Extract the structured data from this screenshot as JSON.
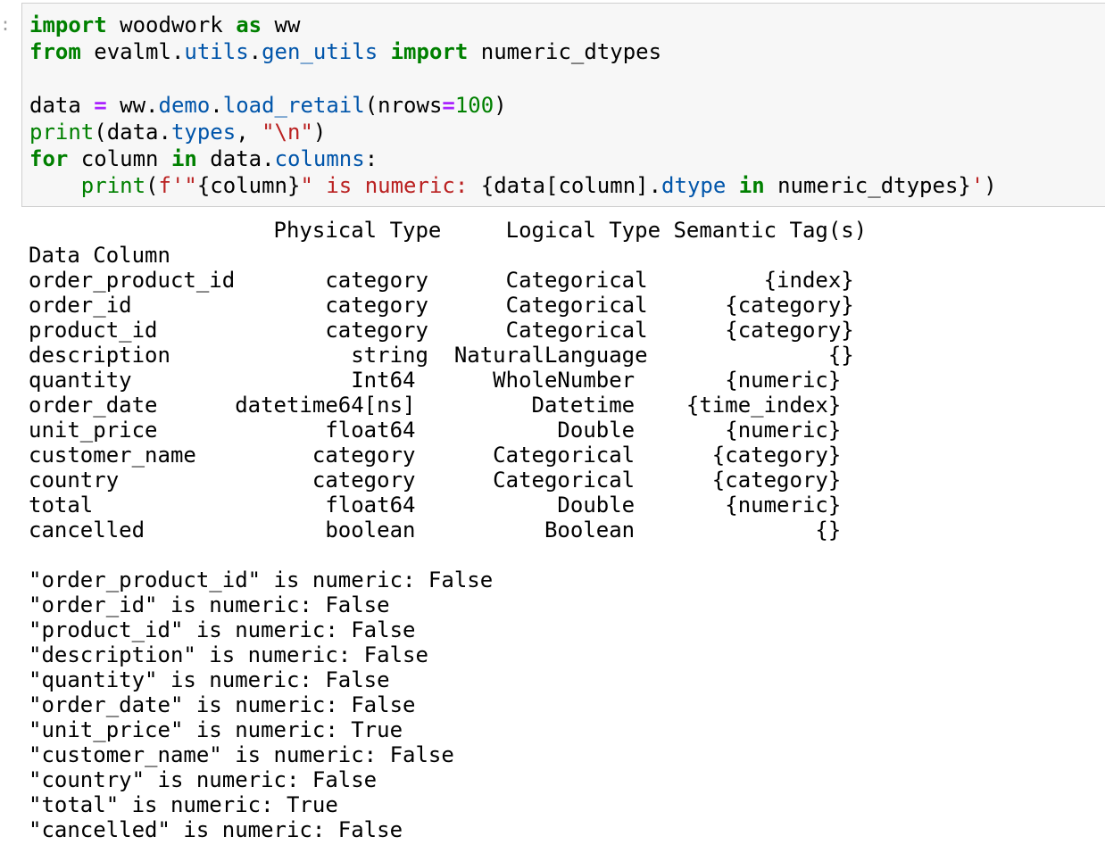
{
  "cell": {
    "prompt": ":",
    "line1": {
      "kw_import": "import",
      "module": " woodwork ",
      "kw_as": "as",
      "alias": " ww"
    },
    "line2": {
      "kw_from": "from",
      "mod_a": " evalml",
      "dot1": ".",
      "mod_b": "utils",
      "dot2": ".",
      "mod_c": "gen_utils",
      "sp": " ",
      "kw_import": "import",
      "name": " numeric_dtypes"
    },
    "line3": {
      "var": "data ",
      "eq1": "=",
      "obj": " ww.",
      "attr1": "demo",
      "dot": ".",
      "attr2": "load_retail",
      "open": "(nrows",
      "eq2": "=",
      "num": "100",
      "close": ")"
    },
    "line4": {
      "fn": "print",
      "open": "(data.",
      "attr": "types",
      "comma": ", ",
      "str": "\"\\n\"",
      "close": ")"
    },
    "line5": {
      "kw_for": "for",
      "var": " column ",
      "kw_in": "in",
      "obj": " data.",
      "attr": "columns",
      "colon": ":"
    },
    "line6": {
      "indent": "    ",
      "fn": "print",
      "open": "(",
      "s1": "f'\"",
      "i1": "{column}",
      "s2": "\" is numeric: ",
      "i2": "{data[column].",
      "attr": "dtype",
      "sp": " ",
      "kw_in": "in",
      "i3": " numeric_dtypes}",
      "s3": "'",
      "close": ")"
    }
  },
  "output": {
    "header": "                   Physical Type     Logical Type Semantic Tag(s)",
    "index_name": "Data Column",
    "rows": [
      "order_product_id       category      Categorical         {index}",
      "order_id               category      Categorical      {category}",
      "product_id             category      Categorical      {category}",
      "description              string  NaturalLanguage              {}",
      "quantity                 Int64      WholeNumber       {numeric}",
      "order_date      datetime64[ns]         Datetime    {time_index}",
      "unit_price             float64           Double       {numeric}",
      "customer_name         category      Categorical      {category}",
      "country               category      Categorical      {category}",
      "total                  float64           Double       {numeric}",
      "cancelled              boolean          Boolean              {}"
    ],
    "numeric_checks": [
      "\"order_product_id\" is numeric: False",
      "\"order_id\" is numeric: False",
      "\"product_id\" is numeric: False",
      "\"description\" is numeric: False",
      "\"quantity\" is numeric: False",
      "\"order_date\" is numeric: False",
      "\"unit_price\" is numeric: True",
      "\"customer_name\" is numeric: False",
      "\"country\" is numeric: False",
      "\"total\" is numeric: True",
      "\"cancelled\" is numeric: False"
    ]
  },
  "colors": {
    "keyword": "#008000",
    "attribute": "#0055aa",
    "operator": "#aa22ff",
    "string": "#ba2121",
    "cell_background": "#f7f7f7",
    "cell_border": "#cfcfcf"
  }
}
